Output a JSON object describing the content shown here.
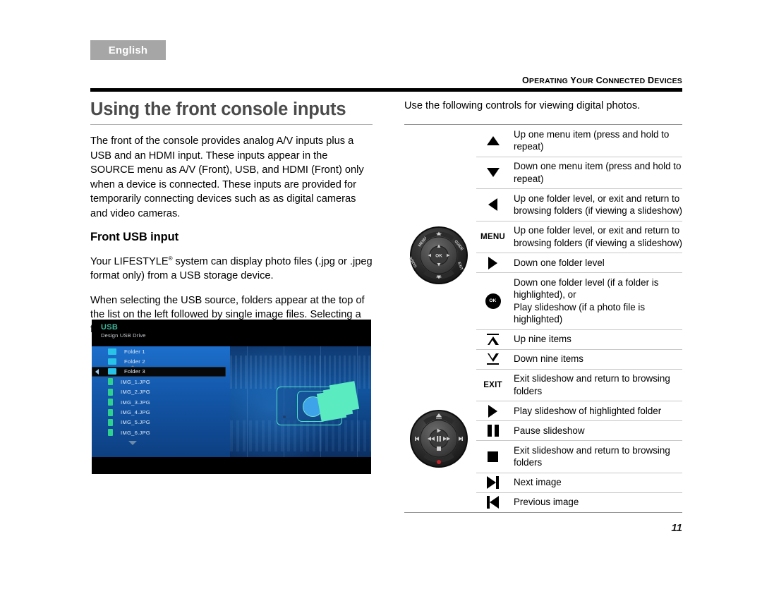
{
  "language_tab": {
    "label": "English"
  },
  "running_head": {
    "text": "Operating Your Connected Devices"
  },
  "left_column": {
    "title": "Using the front console inputs",
    "paragraph_1": "The front of the console provides analog A/V inputs plus a USB and an HDMI input. These inputs appear in the SOURCE menu as A/V (Front), USB, and HDMI (Front) only when a device is connected. These inputs are provided for temporarily connecting devices such as as digital cameras and video cameras.",
    "subhead": "Front USB input",
    "paragraph_2_a": "Your LIFESTYLE",
    "paragraph_2_reg": "®",
    "paragraph_2_b": " system can display photo files (.jpg or .jpeg format only) from a USB storage device.",
    "paragraph_3": "When selecting the USB source, folders appear at the top of the list on the left followed by single image files. Selecting a folder displays its contents."
  },
  "usb_screenshot": {
    "title": "USB",
    "subtitle": "Design USB Drive",
    "items": [
      {
        "label": "Folder 1",
        "type": "folder",
        "selected": false
      },
      {
        "label": "Folder 2",
        "type": "folder",
        "selected": false
      },
      {
        "label": "Folder 3",
        "type": "folder",
        "selected": true
      },
      {
        "label": "IMG_1.JPG",
        "type": "file",
        "selected": false
      },
      {
        "label": "IMG_2.JPG",
        "type": "file",
        "selected": false
      },
      {
        "label": "IMG_3.JPG",
        "type": "file",
        "selected": false
      },
      {
        "label": "IMG_4.JPG",
        "type": "file",
        "selected": false
      },
      {
        "label": "IMG_5.JPG",
        "type": "file",
        "selected": false
      },
      {
        "label": "IMG_6.JPG",
        "type": "file",
        "selected": false
      }
    ],
    "colors": {
      "title": "#3fb79d",
      "folder_icon": "#29c3e8",
      "file_icon": "#2fd18f",
      "list_background": "#1356a8"
    }
  },
  "right_column": {
    "intro": "Use the following controls for viewing digital photos.",
    "controls": [
      {
        "icon": "triangle-up-icon",
        "icon_label": "",
        "description": "Up one menu item (press and hold to repeat)"
      },
      {
        "icon": "triangle-down-icon",
        "icon_label": "",
        "description": "Down one menu item (press and hold to repeat)"
      },
      {
        "icon": "triangle-left-icon",
        "icon_label": "",
        "description": "Up one folder level, or exit and return to browsing folders (if viewing a slideshow)"
      },
      {
        "icon": "menu-button-icon",
        "icon_label": "MENU",
        "description": "Up one folder level, or exit and return to browsing folders (if viewing a slideshow)"
      },
      {
        "icon": "triangle-right-icon",
        "icon_label": "",
        "description": "Down one folder level"
      },
      {
        "icon": "ok-button-icon",
        "icon_label": "OK",
        "description": "Down one folder level (if a folder is highlighted), or",
        "description_2": "Play slideshow (if a photo file is highlighted)"
      },
      {
        "icon": "up-nine-items-icon",
        "icon_label": "",
        "description": "Up nine items"
      },
      {
        "icon": "down-nine-items-icon",
        "icon_label": "",
        "description": "Down nine items"
      },
      {
        "icon": "exit-button-icon",
        "icon_label": "EXIT",
        "description": "Exit slideshow and return to browsing folders"
      },
      {
        "icon": "play-icon",
        "icon_label": "",
        "description": "Play slideshow of highlighted folder"
      },
      {
        "icon": "pause-icon",
        "icon_label": "",
        "description": "Pause slideshow"
      },
      {
        "icon": "stop-icon",
        "icon_label": "",
        "description": "Exit slideshow and return to browsing folders"
      },
      {
        "icon": "next-track-icon",
        "icon_label": "",
        "description": "Next image"
      },
      {
        "icon": "previous-track-icon",
        "icon_label": "",
        "description": "Previous image"
      }
    ],
    "remote_nav_pad": {
      "name": "navigation-pad",
      "buttons": [
        "MENU",
        "GUIDE",
        "EXIT",
        "GUIDE",
        "OK"
      ]
    },
    "remote_playback_pad": {
      "name": "playback-pad",
      "buttons": [
        "play",
        "pause",
        "stop",
        "rewind",
        "fast-forward",
        "previous",
        "next",
        "record"
      ]
    }
  },
  "footer": {
    "page_number": "11"
  }
}
